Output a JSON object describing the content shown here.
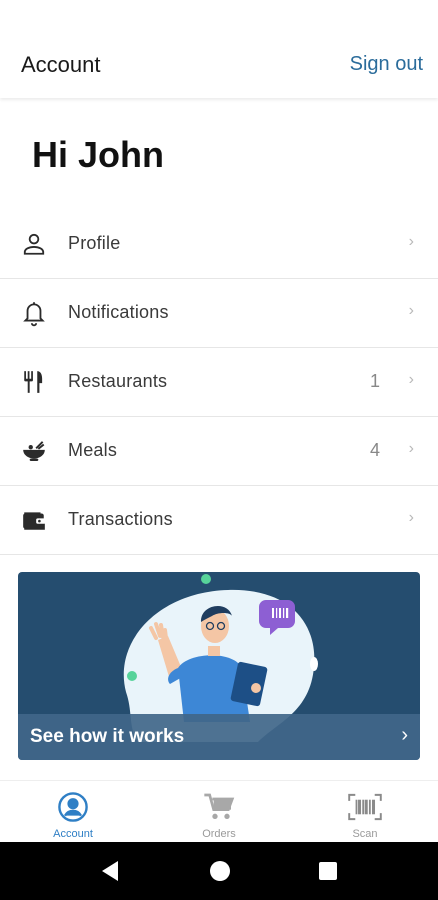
{
  "header": {
    "title": "Account",
    "signout_label": "Sign out"
  },
  "greeting": "Hi John",
  "menu": {
    "items": [
      {
        "label": "Profile",
        "icon": "person-icon",
        "count": ""
      },
      {
        "label": "Notifications",
        "icon": "bell-icon",
        "count": ""
      },
      {
        "label": "Restaurants",
        "icon": "fork-knife-icon",
        "count": "1"
      },
      {
        "label": "Meals",
        "icon": "bowl-icon",
        "count": "4"
      },
      {
        "label": "Transactions",
        "icon": "wallet-icon",
        "count": ""
      }
    ],
    "chevron": "›"
  },
  "promo": {
    "label": "See how it works",
    "chevron": "›"
  },
  "bottom_nav": {
    "items": [
      {
        "label": "Account",
        "icon": "account-circle-icon",
        "active": true
      },
      {
        "label": "Orders",
        "icon": "cart-icon",
        "active": false
      },
      {
        "label": "Scan",
        "icon": "barcode-scan-icon",
        "active": false
      }
    ]
  },
  "colors": {
    "accent": "#2f7fc5",
    "signout": "#2b6c9b",
    "promo_bg": "#254d6f",
    "promo_bar": "#406689"
  }
}
